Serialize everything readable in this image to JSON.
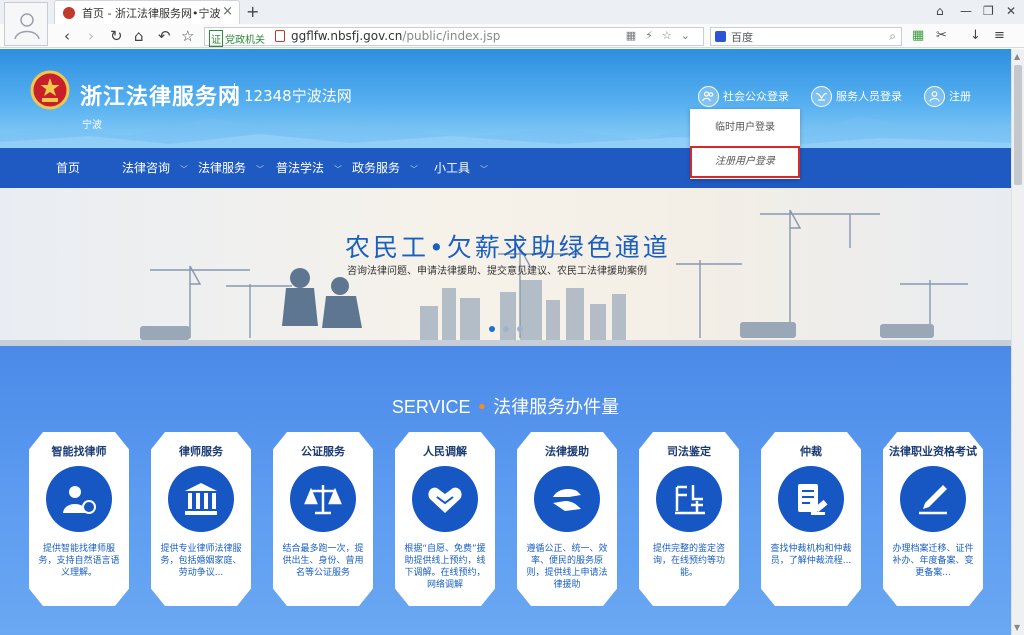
{
  "browser": {
    "tab_title": "首页 - 浙江法律服务网•宁波",
    "new_tab": "+",
    "close_tab": "×",
    "window_controls": [
      "⌂",
      "—",
      "❐",
      "✕"
    ],
    "url_badge": "党政机关",
    "url_badge_mark": "证",
    "url_domain": "ggflfw.nbsfj.gov.cn",
    "url_path": "/public/index.jsp",
    "search_engine": "百度",
    "nav_icons": [
      "back-icon",
      "forward-icon",
      "reload-icon",
      "home-icon",
      "undo-icon",
      "star-icon"
    ]
  },
  "header": {
    "site_title": "浙江法律服务网",
    "subtitle": "12348宁波法网",
    "region": "宁波",
    "login_public": "社会公众登录",
    "login_staff": "服务人员登录",
    "register": "注册"
  },
  "dropdown": {
    "temp_user_login": "临时用户登录",
    "registered_user_login": "注册用户登录"
  },
  "nav": {
    "items": [
      "首页",
      "法律咨询",
      "法律服务",
      "普法学法",
      "政务服务",
      "小工具"
    ]
  },
  "banner": {
    "title": "农民工•欠薪求助绿色通道",
    "subtitle": "咨询法律问题、申请法律援助、提交意见建议、农民工法律援助案例"
  },
  "service": {
    "heading_en": "SERVICE",
    "heading_dot": "•",
    "heading_cn": "法律服务办件量",
    "cards": [
      {
        "title": "智能找律师",
        "desc": "提供智能找律师服务，支持自然语言语义理解。",
        "icon": "lawyer-search-icon"
      },
      {
        "title": "律师服务",
        "desc": "提供专业律师法律服务，包括婚姻家庭、劳动争议...",
        "icon": "law-firm-icon"
      },
      {
        "title": "公证服务",
        "desc": "结合最多跑一次，提供出生、身份、曾用名等公证服务",
        "icon": "scales-icon"
      },
      {
        "title": "人民调解",
        "desc": "根据“自愿、免费”援助提供线上预约，线下调解。在线预约，网络调解",
        "icon": "handshake-icon"
      },
      {
        "title": "法律援助",
        "desc": "遵循公正、统一、效率、便民的服务原则，提供线上申请法律援助",
        "icon": "helping-hand-icon"
      },
      {
        "title": "司法鉴定",
        "desc": "提供完整的鉴定咨询，在线预约等功能。",
        "icon": "appraisal-icon"
      },
      {
        "title": "仲裁",
        "desc": "查找仲裁机构和仲裁员，了解仲裁流程...",
        "icon": "arbitration-icon"
      },
      {
        "title": "法律职业资格考试",
        "desc": "办理档案迁移、证件补办、年度备案、变更备案...",
        "icon": "exam-pen-icon"
      }
    ]
  },
  "colors": {
    "nav_bg": "#1f5ac3",
    "service_bg": "#4b8ae8",
    "accent_orange": "#ff8a1c",
    "highlight_red": "#d42a2a"
  }
}
